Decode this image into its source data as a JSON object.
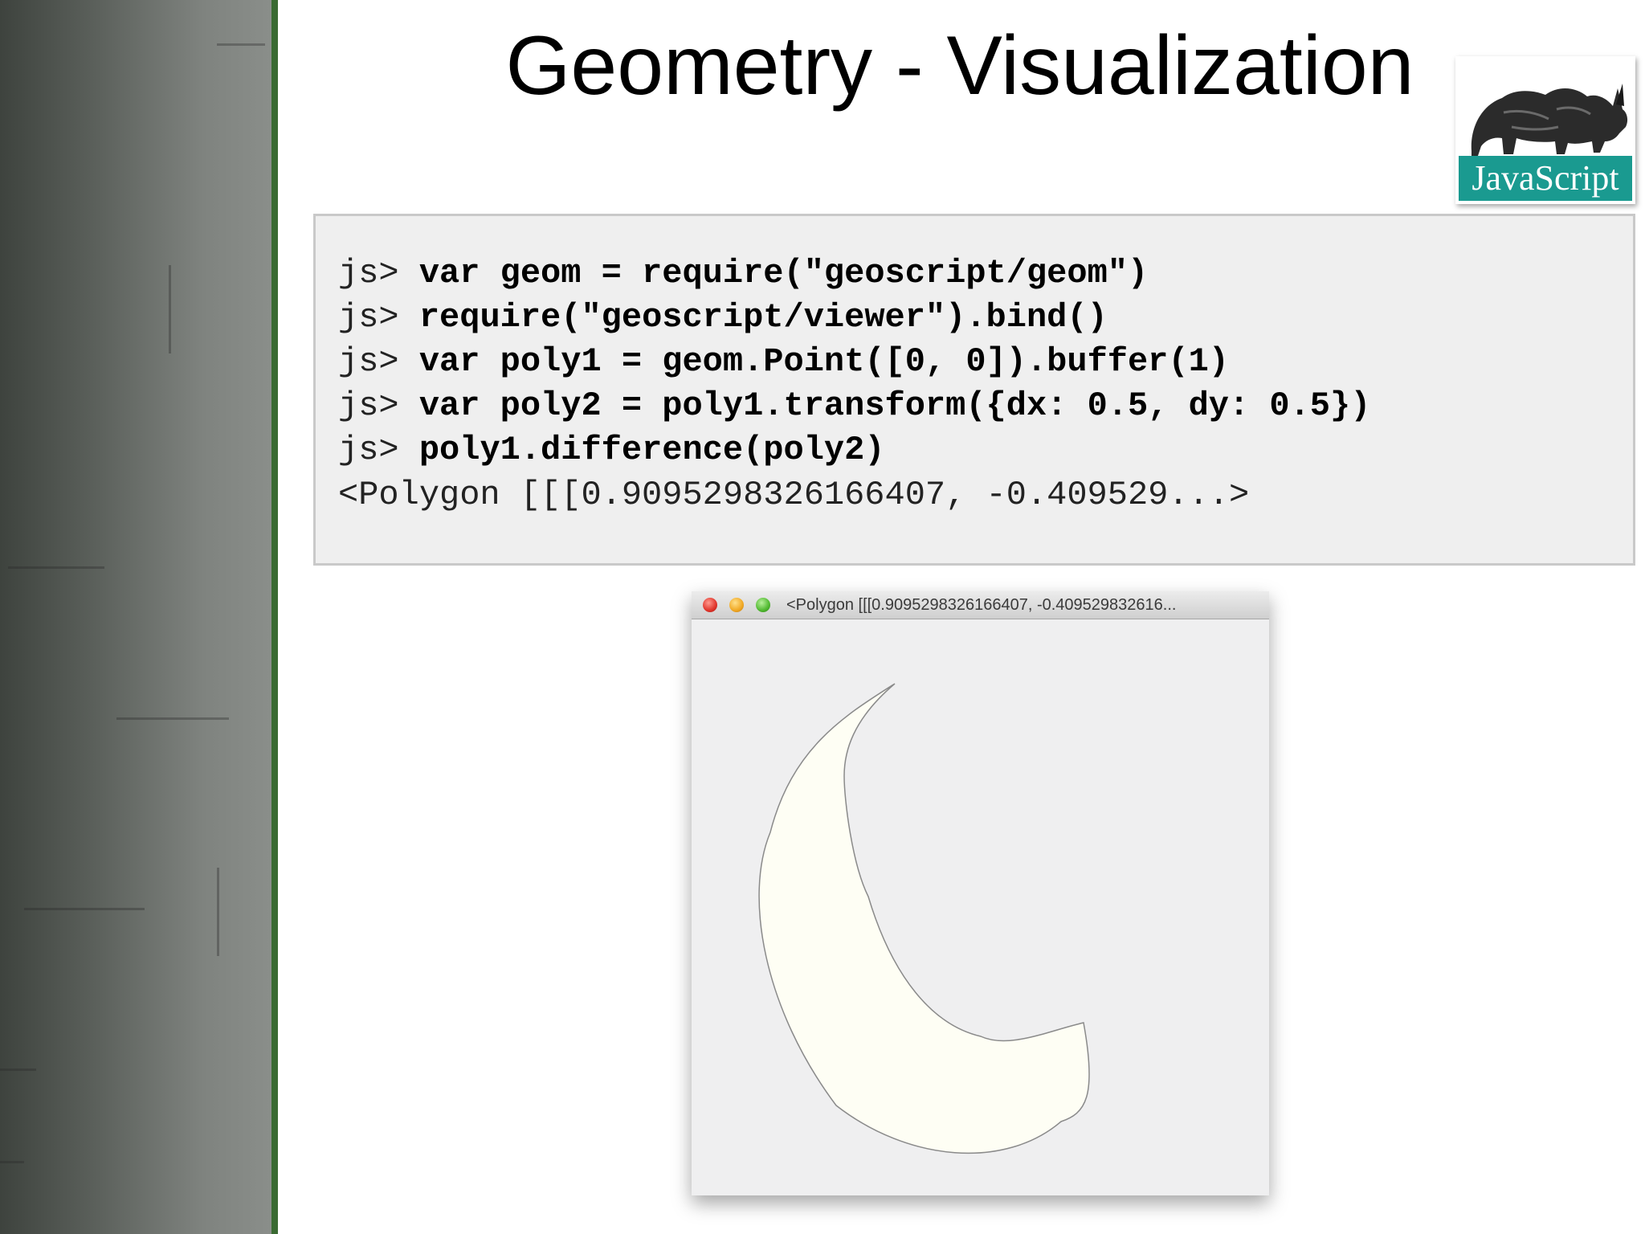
{
  "slide": {
    "title": "Geometry - Visualization",
    "logo": {
      "text": "JavaScript",
      "icon": "rhino-icon",
      "banner_color": "#1a9a90"
    }
  },
  "code": {
    "lines": [
      {
        "prompt": "js> ",
        "command": "var geom = require(\"geoscript/geom\")"
      },
      {
        "prompt": "js> ",
        "command": "require(\"geoscript/viewer\").bind()"
      },
      {
        "prompt": "js> ",
        "command": "var poly1 = geom.Point([0, 0]).buffer(1)"
      },
      {
        "prompt": "js> ",
        "command": "var poly2 = poly1.transform({dx: 0.5, dy: 0.5})"
      },
      {
        "prompt": "js> ",
        "command": "poly1.difference(poly2)"
      }
    ],
    "result": "<Polygon [[[0.9095298326166407, -0.409529...>"
  },
  "viewer_window": {
    "title": "<Polygon [[[0.9095298326166407, -0.409529832616...",
    "shape_fill": "#fefef4",
    "shape_stroke": "#8a8a8a",
    "background": "#efeff0"
  },
  "colors": {
    "sidebar_dark": "#3e433e",
    "sidebar_stripe": "#3a6a32",
    "code_background": "#efefef"
  }
}
